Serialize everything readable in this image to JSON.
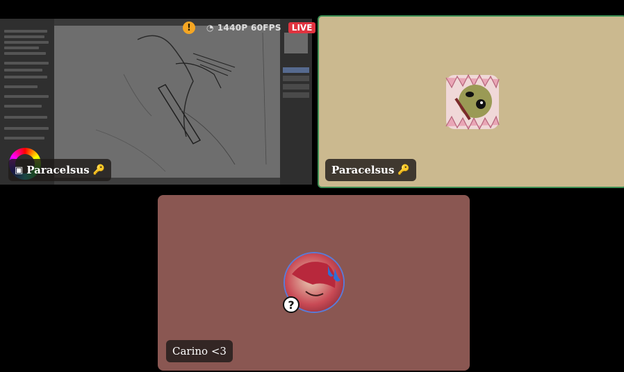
{
  "stream": {
    "warning_icon": "exclamation",
    "quality": "1440P 60FPS",
    "live": "LIVE"
  },
  "tiles": [
    {
      "name": "Paracelsus",
      "kind": "screenshare",
      "icons": [
        "screen-share-icon",
        "key-icon"
      ]
    },
    {
      "name": "Paracelsus",
      "kind": "camera",
      "speaking": true,
      "icons": [
        "key-icon"
      ]
    },
    {
      "name": "Carino <3",
      "kind": "camera",
      "icons": [
        "question-icon"
      ]
    }
  ],
  "colors": {
    "speaking_border": "#3d9155",
    "live_red": "#e0333f",
    "warning": "#f5a623",
    "para_bg": "#cbb98f",
    "carino_bg": "#8a5752"
  }
}
